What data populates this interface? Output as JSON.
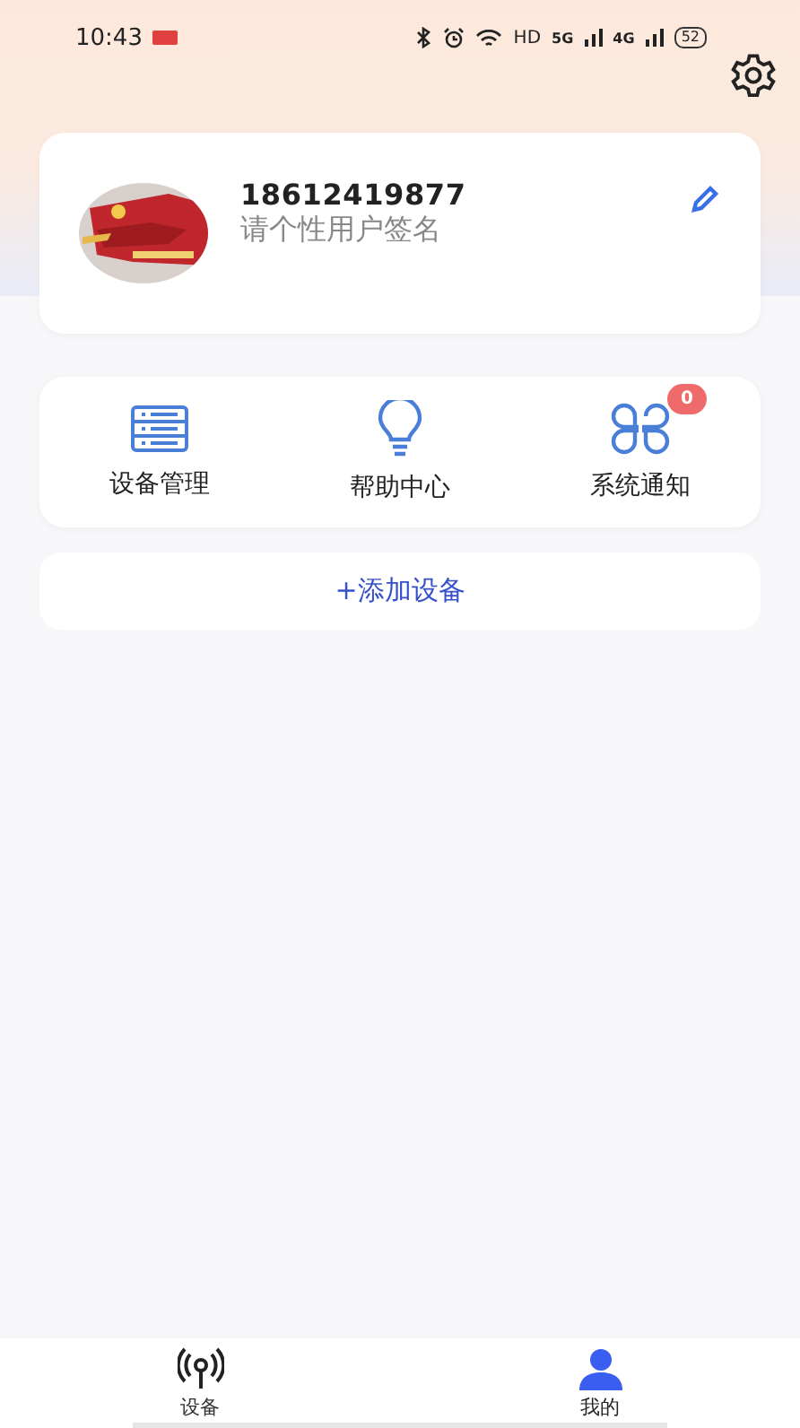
{
  "status_bar": {
    "time": "10:43",
    "hd": "HD",
    "net_5g": "5G",
    "net_4g": "4G",
    "battery": "52"
  },
  "profile": {
    "phone": "18612419877",
    "signature": "请个性用户签名"
  },
  "menu": [
    {
      "kind": "list",
      "label": "设备管理"
    },
    {
      "kind": "bulb",
      "label": "帮助中心"
    },
    {
      "kind": "grid",
      "label": "系统通知",
      "badge": "0"
    }
  ],
  "add_button": "+添加设备",
  "tabs": [
    {
      "kind": "device",
      "label": "设备",
      "selected": false
    },
    {
      "kind": "user",
      "label": "我的",
      "selected": true
    }
  ]
}
